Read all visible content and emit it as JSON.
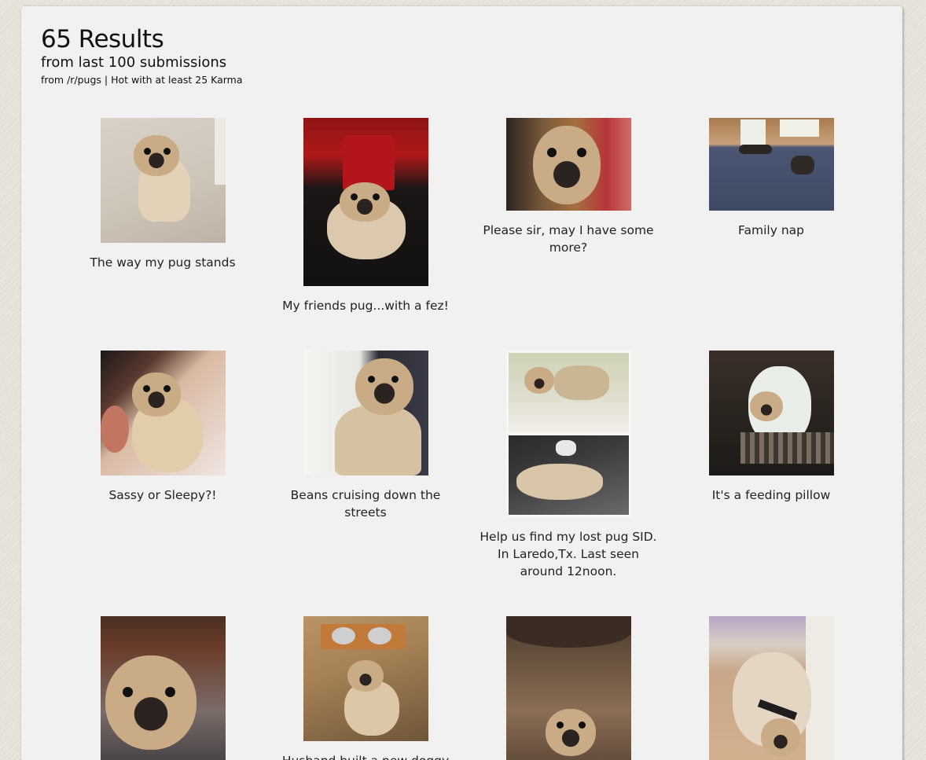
{
  "header": {
    "title": "65 Results",
    "subtitle": "from last 100 submissions",
    "meta": "from /r/pugs | Hot with at least 25 Karma"
  },
  "results": [
    {
      "caption": "The way my pug stands",
      "image": "pug-standing-on-carpet-photo"
    },
    {
      "caption": "My friends pug...with a fez!",
      "image": "pug-wearing-red-fez-photo"
    },
    {
      "caption": "Please sir, may I have some more?",
      "image": "pug-closeup-face-photo"
    },
    {
      "caption": "Family nap",
      "image": "pugs-napping-on-floor-photo"
    },
    {
      "caption": "Sassy or Sleepy?!",
      "image": "pug-with-person-in-bed-photo"
    },
    {
      "caption": "Beans cruising down the streets",
      "image": "pug-in-car-window-photo"
    },
    {
      "caption": "Help us find my lost pug SID. In Laredo,Tx. Last seen around 12noon.",
      "image": "lost-pug-collage-photo"
    },
    {
      "caption": "It's a feeding pillow",
      "image": "pug-on-feeding-pillow-photo"
    },
    {
      "caption": "",
      "image": "pug-puppy-held-photo"
    },
    {
      "caption": "Husband built a new doggy",
      "image": "pug-with-food-bowls-photo"
    },
    {
      "caption": "",
      "image": "pug-in-tree-hollow-photo"
    },
    {
      "caption": "",
      "image": "pug-lying-on-floor-photo"
    }
  ]
}
